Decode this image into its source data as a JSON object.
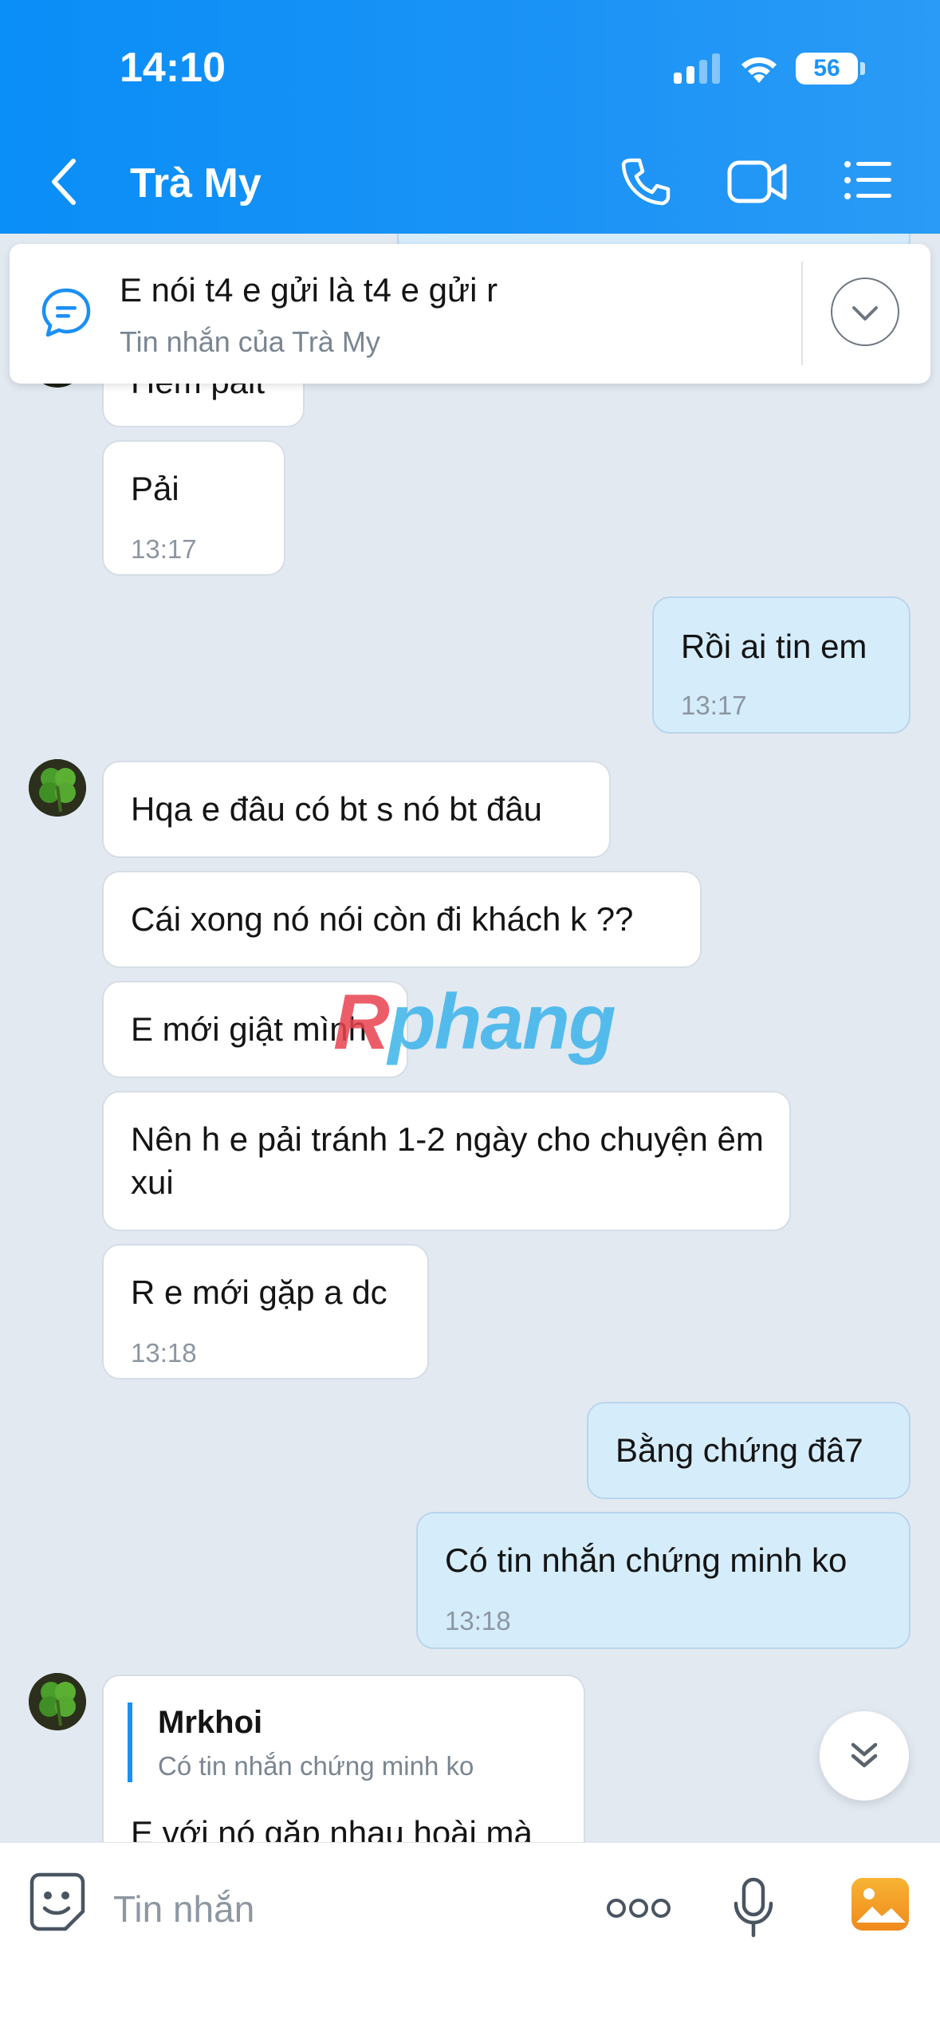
{
  "status_bar": {
    "time": "14:10",
    "battery": "56"
  },
  "header": {
    "contact_name": "Trà My"
  },
  "pinned": {
    "text": "E nói t4 e gửi là t4 e gửi r",
    "subtitle": "Tin nhắn của Trà My"
  },
  "messages": [
    {
      "dir": "in",
      "text": "Hem pait"
    },
    {
      "dir": "in",
      "text": "Pải",
      "time": "13:17"
    },
    {
      "dir": "out",
      "text": "Rồi ai tin em",
      "time": "13:17"
    },
    {
      "dir": "in",
      "text": "Hqa e đâu có bt s nó bt đâu"
    },
    {
      "dir": "in",
      "text": "Cái xong nó nói còn đi khách k ??"
    },
    {
      "dir": "in",
      "text": "E mới giật mình"
    },
    {
      "dir": "in",
      "text": "Nên h e pải tránh 1-2 ngày cho chuyện êm xui"
    },
    {
      "dir": "in",
      "text": "R e mới gặp a dc",
      "time": "13:18"
    },
    {
      "dir": "out",
      "text": "Bằng chứng đâ7"
    },
    {
      "dir": "out",
      "text": "Có tin nhắn chứng minh ko",
      "time": "13:18"
    },
    {
      "dir": "in",
      "reply_to_name": "Mrkhoi",
      "reply_to_text": "Có tin nhắn chứng minh ko",
      "text": "E với nó gặp nhau hoài mà"
    }
  ],
  "watermark": {
    "r": "R",
    "rest": "phang"
  },
  "input": {
    "placeholder": "Tin nhắn"
  },
  "colors": {
    "header": "#1b93f6",
    "outgoing_bubble": "#d5ecfb",
    "incoming_bubble": "#ffffff",
    "background": "#e2e9f1",
    "accent": "#1b8ff5"
  },
  "icons": [
    "back-arrow-icon",
    "phone-icon",
    "video-camera-icon",
    "menu-list-icon",
    "chat-bubble-icon",
    "chevron-down-icon",
    "double-chevron-down-icon",
    "sticker-face-icon",
    "more-dots-icon",
    "microphone-icon",
    "gallery-image-icon",
    "clover-avatar-icon"
  ]
}
